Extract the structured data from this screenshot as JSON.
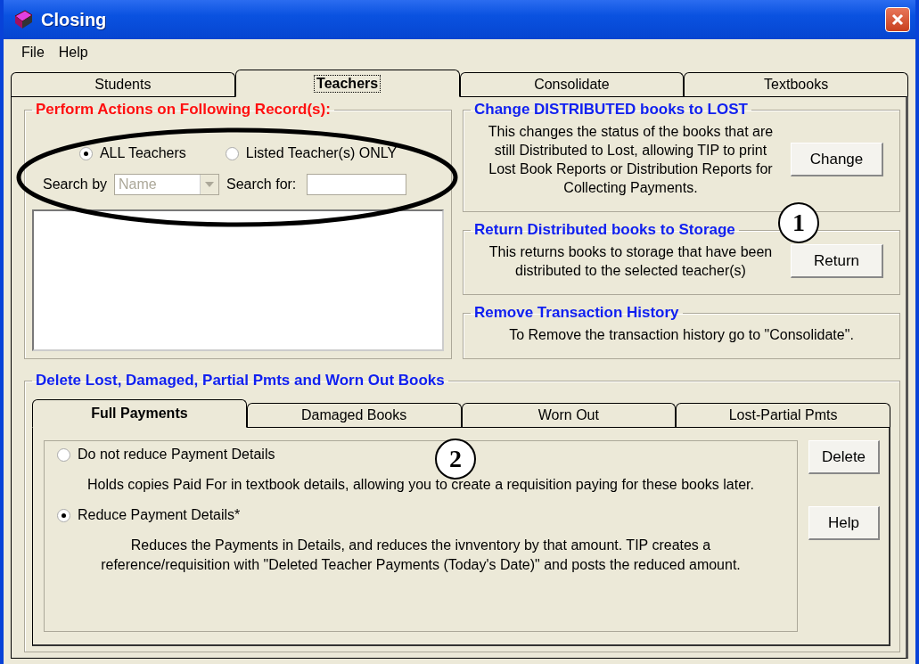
{
  "window": {
    "title": "Closing"
  },
  "menu": [
    "File",
    "Help"
  ],
  "tabs": [
    {
      "label": "Students",
      "selected": false
    },
    {
      "label": "Teachers",
      "selected": true
    },
    {
      "label": "Consolidate",
      "selected": false
    },
    {
      "label": "Textbooks",
      "selected": false
    }
  ],
  "records_group": {
    "title": "Perform Actions on Following Record(s):",
    "options": [
      {
        "label": "ALL Teachers",
        "selected": true
      },
      {
        "label": "Listed Teacher(s) ONLY",
        "selected": false
      }
    ],
    "search_by": {
      "label": "Search by",
      "value": "Name",
      "disabled": true
    },
    "search_for": {
      "label": "Search for:"
    }
  },
  "actions": [
    {
      "title": "Change DISTRIBUTED books to LOST",
      "description": "This changes the status of the books that are still Distributed to Lost, allowing TIP to print Lost Book Reports or Distribution Reports for Collecting Payments.",
      "button": "Change"
    },
    {
      "title": "Return Distributed books to Storage",
      "description": "This returns books to storage that have been distributed to the selected teacher(s)",
      "button": "Return"
    },
    {
      "title": "Remove Transaction History",
      "description": "To Remove the transaction history go to \"Consolidate\"."
    }
  ],
  "callouts": [
    "1",
    "2"
  ],
  "delete_group": {
    "title": "Delete Lost, Damaged, Partial Pmts and Worn  Out Books",
    "tabs": [
      {
        "label": "Full Payments",
        "selected": true
      },
      {
        "label": "Damaged Books",
        "selected": false
      },
      {
        "label": "Worn Out",
        "selected": false
      },
      {
        "label": "Lost-Partial Pmts",
        "selected": false
      }
    ],
    "options": [
      {
        "label": "Do not reduce Payment Details",
        "selected": false,
        "description": "Holds copies Paid For in textbook details, allowing you to create a requisition paying for these books later."
      },
      {
        "label": "Reduce Payment Details*",
        "selected": true,
        "description": "Reduces the Payments in Details, and reduces the ivnventory by that amount.  TIP creates a reference/requisition with \"Deleted Teacher Payments (Today's Date)\" and posts the reduced amount."
      }
    ],
    "buttons": [
      "Delete",
      "Help"
    ]
  }
}
